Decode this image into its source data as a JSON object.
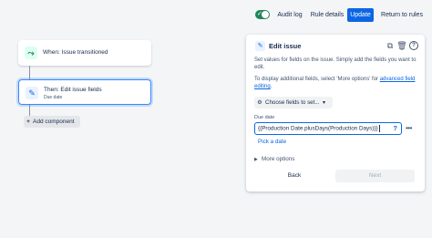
{
  "header": {
    "toggle_on": true,
    "audit_log": "Audit log",
    "rule_details": "Rule details",
    "update": "Update",
    "return_to_rules": "Return to rules"
  },
  "flow": {
    "trigger": {
      "label": "When: Issue transitioned",
      "icon": "transition-icon"
    },
    "action": {
      "label": "Then: Edit issue fields",
      "sublabel": "Due date",
      "icon": "pencil-icon"
    },
    "add_component": "Add component"
  },
  "panel": {
    "title": "Edit issue",
    "description": "Set values for fields on the issue. Simply add the fields you want to edit.",
    "hint_prefix": "To display additional fields, select 'More options' for ",
    "hint_link": "advanced field editing",
    "hint_suffix": ".",
    "choose_fields": "Choose fields to set...",
    "field": {
      "label": "Due date",
      "value": "{{Production Date.plusDays(Production Days)}}",
      "pick_date": "Pick a date"
    },
    "more_options": "More options",
    "back": "Back",
    "next": "Next"
  },
  "colors": {
    "accent": "#0c66e4",
    "toggle": "#1f845a",
    "selected_border": "#388bff"
  }
}
